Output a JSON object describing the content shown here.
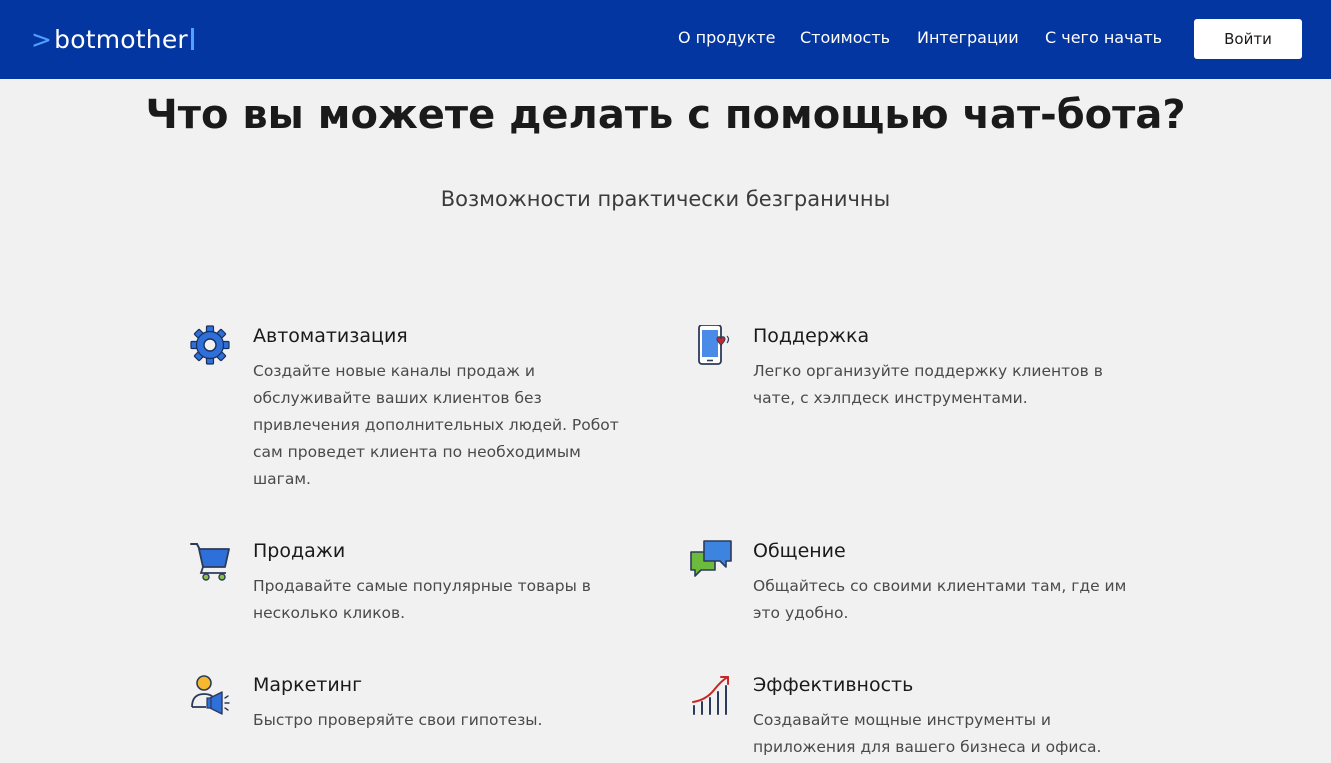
{
  "header": {
    "logo_text": "botmother",
    "logo_chevron": ">",
    "nav": [
      {
        "label": "О продукте"
      },
      {
        "label": "Стоимость"
      },
      {
        "label": "Интеграции"
      },
      {
        "label": "С чего начать"
      }
    ],
    "login_label": "Войти"
  },
  "main": {
    "title": "Что вы можете делать с помощью чат-бота?",
    "subtitle": "Возможности практически безграничны",
    "features": [
      {
        "icon": "gear-icon",
        "title": "Автоматизация",
        "lines": [
          "Создайте новые каналы продаж и",
          "обслуживайте ваших клиентов без",
          "привлечения дополнительных людей. Робот",
          "сам проведет клиента по необходимым",
          "шагам."
        ]
      },
      {
        "icon": "phone-heart-icon",
        "title": "Поддержка",
        "lines": [
          "Легко организуйте поддержку клиентов в",
          "чате, с хэлпдеск инструментами."
        ]
      },
      {
        "icon": "shopping-cart-icon",
        "title": "Продажи",
        "lines": [
          "Продавайте самые популярные товары в",
          "несколько кликов."
        ]
      },
      {
        "icon": "chat-bubbles-icon",
        "title": "Общение",
        "lines": [
          "Общайтесь со своими клиентами там, где им",
          "это удобно."
        ]
      },
      {
        "icon": "megaphone-person-icon",
        "title": "Маркетинг",
        "lines": [
          "Быстро проверяйте свои гипотезы."
        ]
      },
      {
        "icon": "growth-chart-icon",
        "title": "Эффективность",
        "lines": [
          "Создавайте мощные инструменты и",
          "приложения для вашего бизнеса и офиса."
        ]
      }
    ]
  },
  "colors": {
    "header_bg": "#0436a1",
    "page_bg": "#f1f1f1",
    "accent_blue": "#2e6fd9",
    "logo_accent": "#4fa3ff"
  }
}
